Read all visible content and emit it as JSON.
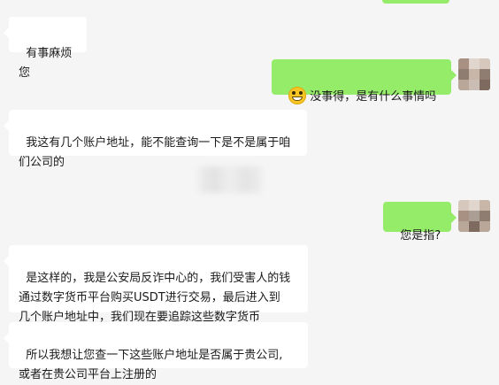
{
  "messages": [
    {
      "side": "left",
      "text": "有事麻烦您"
    },
    {
      "side": "right",
      "emoji": "grinning-face-emoji",
      "text": "没事得，是有什么事情吗"
    },
    {
      "side": "left",
      "text": "我这有几个账户地址，能不能查询一下是不是属于咱\n们公司的"
    },
    {
      "side": "right",
      "text": "您是指?"
    },
    {
      "side": "left",
      "text": "是这样的，我是公安局反诈中心的，我们受害人的钱\n通过数字货币平台购买USDT进行交易，最后进入到\n几个账户地址中，我们现在要追踪这些数字货币"
    },
    {
      "side": "left",
      "text": "所以我想让您查一下这些账户地址是否属于贵公司,\n或者在贵公司平台上注册的"
    }
  ],
  "colors": {
    "background": "#f5f5f5",
    "incoming_bubble": "#ffffff",
    "outgoing_bubble": "#95ec69"
  }
}
